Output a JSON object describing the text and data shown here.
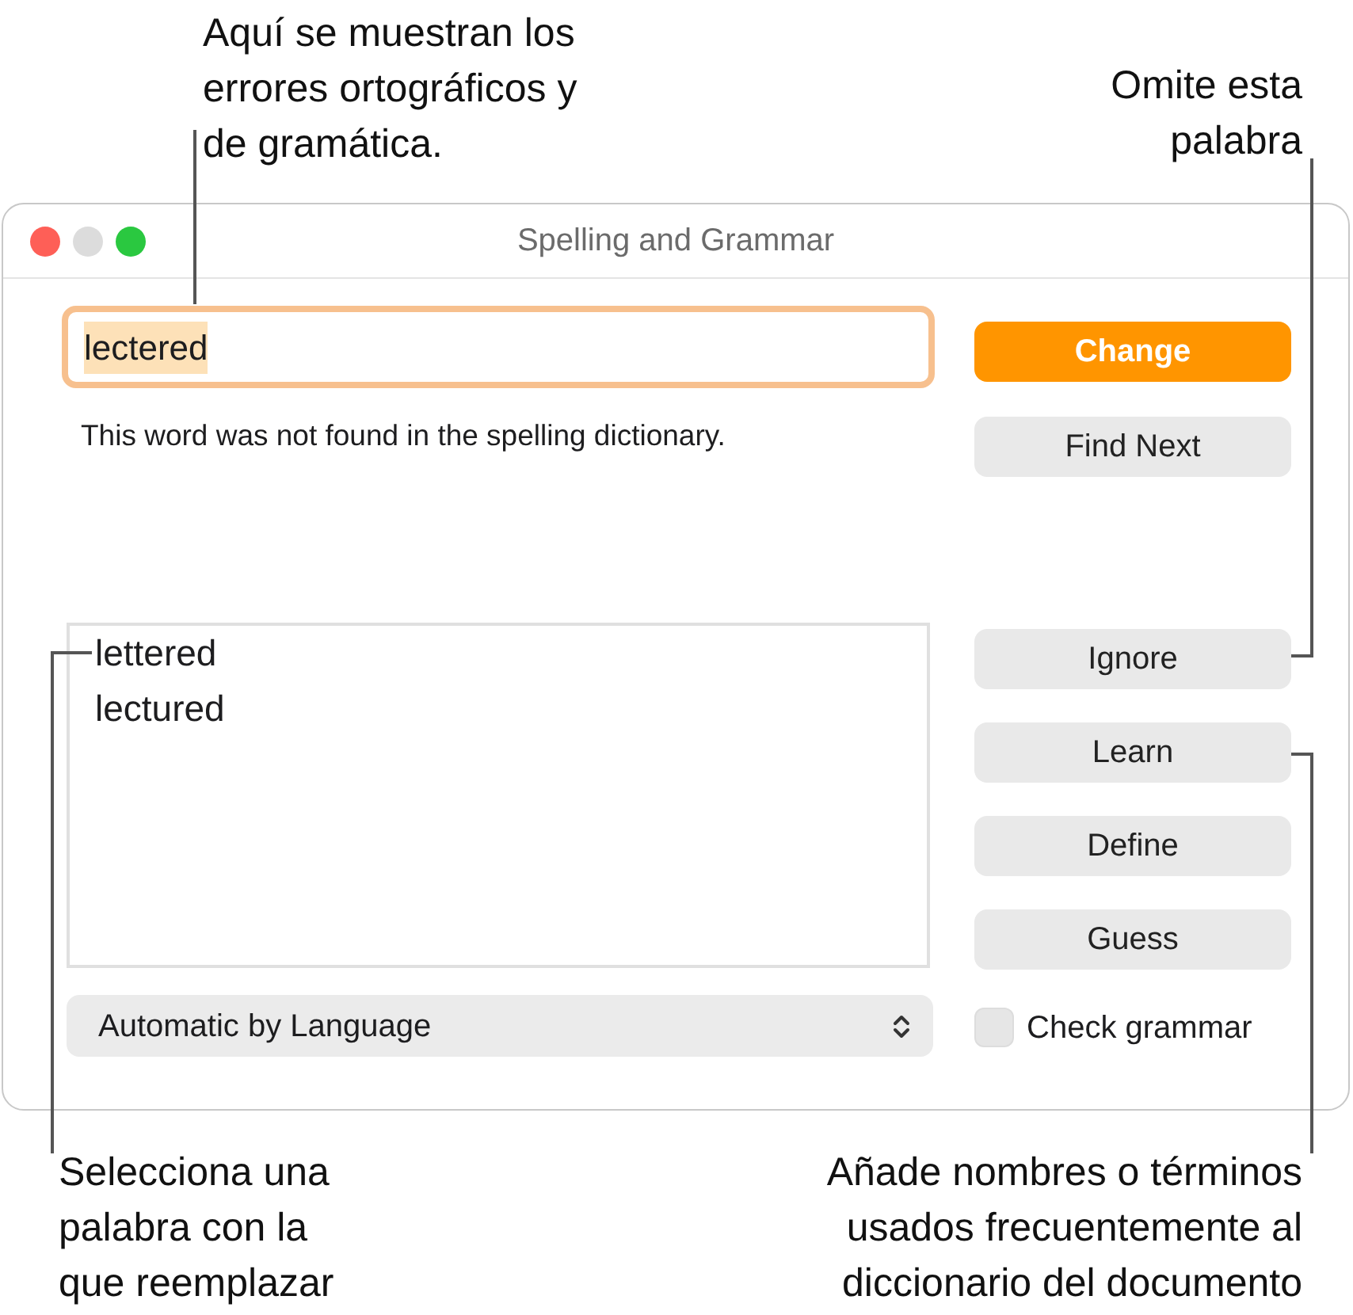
{
  "callouts": [
    {
      "kind": "top-left",
      "lines": [
        "Aquí se muestran los",
        "errores ortográficos y",
        "de gramática."
      ]
    },
    {
      "kind": "top-right",
      "lines": [
        "Omite esta",
        "palabra"
      ]
    },
    {
      "kind": "bottom-left",
      "lines": [
        "Selecciona una",
        "palabra con la",
        "que reemplazar"
      ]
    },
    {
      "kind": "bottom-right",
      "lines": [
        "Añade nombres o términos",
        "usados frecuentemente al",
        "diccionario del documento"
      ]
    }
  ],
  "window": {
    "title": "Spelling and Grammar"
  },
  "word_field": {
    "value": "lectered",
    "focused": true
  },
  "message": "This word was not found in the spelling dictionary.",
  "suggestions": [
    {
      "label": "lettered",
      "selected": false
    },
    {
      "label": "lectured",
      "selected": false
    }
  ],
  "language_popup": {
    "value": "Automatic by Language"
  },
  "buttons": [
    {
      "label": "Change",
      "kind": "default"
    },
    {
      "label": "Find Next",
      "kind": "normal"
    },
    {
      "label": "Ignore",
      "kind": "normal"
    },
    {
      "label": "Learn",
      "kind": "normal"
    },
    {
      "label": "Define",
      "kind": "normal"
    },
    {
      "label": "Guess",
      "kind": "normal"
    }
  ],
  "check_grammar": {
    "label": "Check grammar",
    "checked": false
  }
}
